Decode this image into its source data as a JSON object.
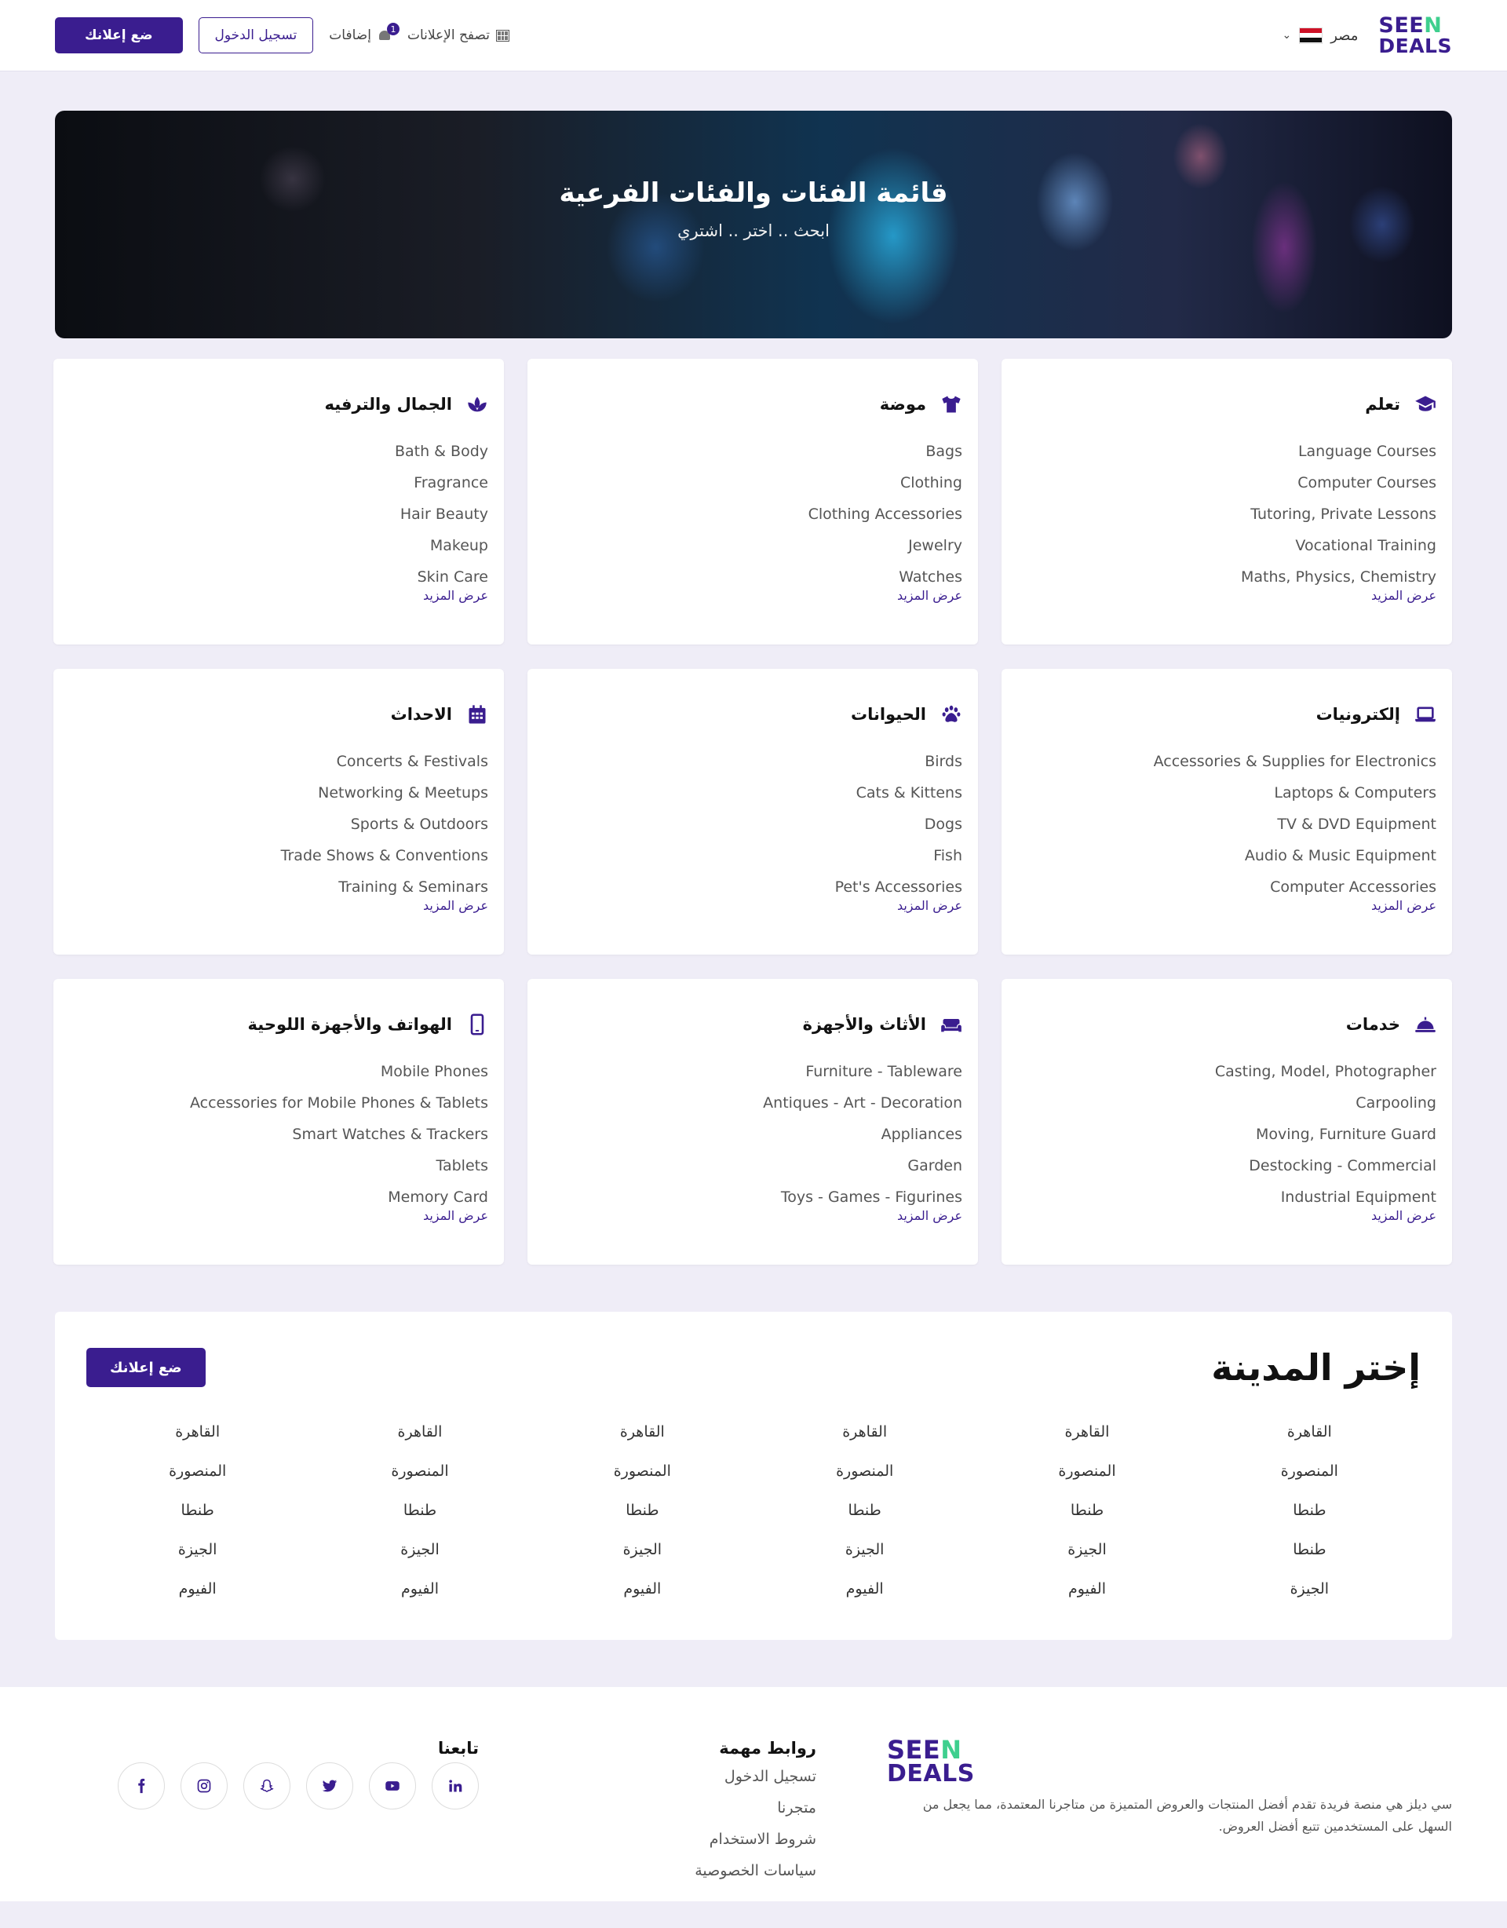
{
  "header": {
    "logo_line1_a": "SEE",
    "logo_line1_b": "N",
    "logo_line2": "DEALS",
    "country": "مصر",
    "browse_label": "تصفح الإعلانات",
    "notifications_label": "إضافات",
    "notifications_count": "1",
    "login_label": "تسجيل الدخول",
    "post_ad_label": "ضع إعلانك"
  },
  "hero": {
    "title": "قائمة الفئات والفئات الفرعية",
    "subtitle": "ابحث .. اختر .. اشتري"
  },
  "more_label": "عرض المزيد",
  "categories": [
    {
      "title": "تعلم",
      "icon": "graduation-cap-icon",
      "items": [
        "Language Courses",
        "Computer Courses",
        "Tutoring, Private Lessons",
        "Vocational Training",
        "Maths, Physics, Chemistry"
      ]
    },
    {
      "title": "موضة",
      "icon": "t-shirt-icon",
      "items": [
        "Bags",
        "Clothing",
        "Clothing Accessories",
        "Jewelry",
        "Watches"
      ]
    },
    {
      "title": "الجمال والترفيه",
      "icon": "spa-icon",
      "items": [
        "Bath & Body",
        "Fragrance",
        "Hair Beauty",
        "Makeup",
        "Skin Care"
      ]
    },
    {
      "title": "إلكترونيات",
      "icon": "laptop-icon",
      "items": [
        "Accessories & Supplies for Electronics",
        "Laptops & Computers",
        "TV & DVD Equipment",
        "Audio & Music Equipment",
        "Computer Accessories"
      ]
    },
    {
      "title": "الحيوانات",
      "icon": "paw-icon",
      "items": [
        "Birds",
        "Cats & Kittens",
        "Dogs",
        "Fish",
        "Pet's Accessories"
      ]
    },
    {
      "title": "الاحداث",
      "icon": "calendar-icon",
      "items": [
        "Concerts & Festivals",
        "Networking & Meetups",
        "Sports & Outdoors",
        "Trade Shows & Conventions",
        "Training & Seminars"
      ]
    },
    {
      "title": "خدمات",
      "icon": "service-bell-icon",
      "items": [
        "Casting, Model, Photographer",
        "Carpooling",
        "Moving, Furniture Guard",
        "Destocking - Commercial",
        "Industrial Equipment"
      ]
    },
    {
      "title": "الأثاث والأجهزة",
      "icon": "couch-icon",
      "items": [
        "Furniture - Tableware",
        "Antiques - Art - Decoration",
        "Appliances",
        "Garden",
        "Toys - Games - Figurines"
      ]
    },
    {
      "title": "الهواتف والأجهزة اللوحية",
      "icon": "mobile-icon",
      "items": [
        "Mobile Phones",
        "Accessories for Mobile Phones & Tablets",
        "Smart Watches & Trackers",
        "Tablets",
        "Memory Card"
      ]
    }
  ],
  "cities": {
    "title": "إختر المدينة",
    "post_ad_label": "ضع إعلانك",
    "columns": [
      [
        "القاهرة",
        "المنصورة",
        "طنطا",
        "طنطا",
        "الجيزة"
      ],
      [
        "القاهرة",
        "المنصورة",
        "طنطا",
        "الجيزة",
        "الفيوم"
      ],
      [
        "القاهرة",
        "المنصورة",
        "طنطا",
        "الجيزة",
        "الفيوم"
      ],
      [
        "القاهرة",
        "المنصورة",
        "طنطا",
        "الجيزة",
        "الفيوم"
      ],
      [
        "القاهرة",
        "المنصورة",
        "طنطا",
        "الجيزة",
        "الفيوم"
      ],
      [
        "القاهرة",
        "المنصورة",
        "طنطا",
        "الجيزة",
        "الفيوم"
      ]
    ]
  },
  "footer": {
    "description": "سي ديلز هي منصة فريدة تقدم أفضل المنتجات والعروض المتميزة من متاجرنا المعتمدة، مما يجعل من السهل على المستخدمين تتبع أفضل العروض.",
    "links_title": "روابط مهمة",
    "links": [
      "تسجيل الدخول",
      "متجرنا",
      "شروط الاستخدام",
      "سياسات الخصوصية"
    ],
    "follow_title": "تابعنا",
    "social": [
      "facebook-icon",
      "instagram-icon",
      "snapchat-icon",
      "twitter-icon",
      "youtube-icon",
      "linkedin-icon"
    ]
  },
  "colors": {
    "brand": "#3a1d8f",
    "accent": "#3ecf8e",
    "background": "#efedf7"
  }
}
